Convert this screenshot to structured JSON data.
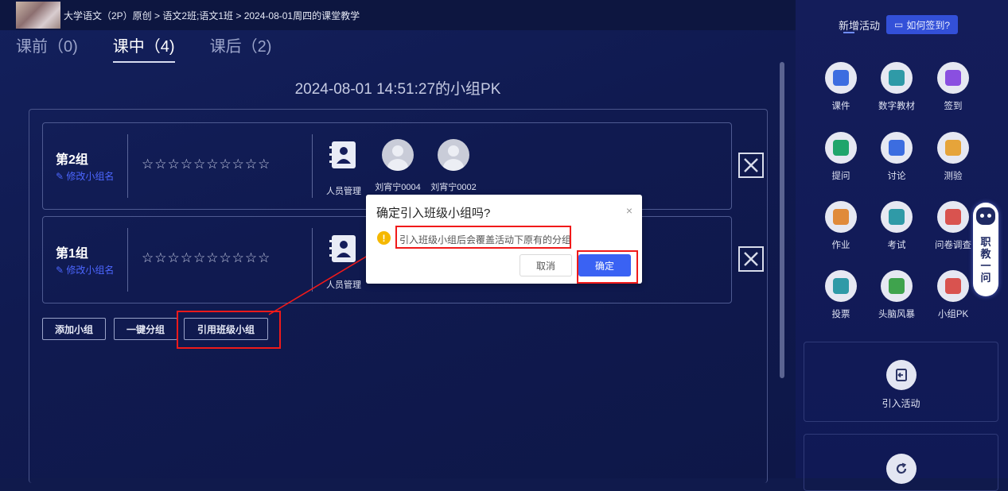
{
  "breadcrumb": "大学语文（2P）原创 > 语文2班;语文1班 > 2024-08-01周四的课堂教学",
  "tabs": [
    {
      "label": "课前（0)",
      "active": false
    },
    {
      "label": "课中（4)",
      "active": true
    },
    {
      "label": "课后（2)",
      "active": false
    }
  ],
  "pk_title": "2024-08-01 14:51:27的小组PK",
  "groups": [
    {
      "name": "第2组",
      "rename": "修改小组名",
      "stars": "☆☆☆☆☆☆☆☆☆☆",
      "manage_label": "人员管理",
      "members": [
        "刘宵宁0004",
        "刘宵宁0002"
      ]
    },
    {
      "name": "第1组",
      "rename": "修改小组名",
      "stars": "☆☆☆☆☆☆☆☆☆☆",
      "manage_label": "人员管理",
      "members": []
    }
  ],
  "actions": {
    "add_group": "添加小组",
    "auto_group": "一键分组",
    "import_group": "引用班级小组"
  },
  "dialog": {
    "title": "确定引入班级小组吗?",
    "message": "引入班级小组后会覆盖活动下原有的分组",
    "cancel": "取消",
    "ok": "确定",
    "close": "×"
  },
  "right_panel": {
    "header": "新增活动",
    "howto": "如何签到?",
    "tools": [
      {
        "label": "课件",
        "icon": "courseware-icon",
        "color": "#3c6de0"
      },
      {
        "label": "数字教材",
        "icon": "digital-textbook-icon",
        "color": "#2f9aa7"
      },
      {
        "label": "签到",
        "icon": "check-in-icon",
        "color": "#8a4fe0"
      },
      {
        "label": "提问",
        "icon": "question-icon",
        "color": "#1fa56b"
      },
      {
        "label": "讨论",
        "icon": "discussion-icon",
        "color": "#3c6de0"
      },
      {
        "label": "测验",
        "icon": "quiz-icon",
        "color": "#e6a43a"
      },
      {
        "label": "作业",
        "icon": "homework-icon",
        "color": "#e08a3a"
      },
      {
        "label": "考试",
        "icon": "exam-icon",
        "color": "#2f9aa7"
      },
      {
        "label": "问卷调查",
        "icon": "survey-icon",
        "color": "#d9534f"
      },
      {
        "label": "投票",
        "icon": "vote-icon",
        "color": "#2f9aa7"
      },
      {
        "label": "头脑风暴",
        "icon": "brainstorm-icon",
        "color": "#3fa34d"
      },
      {
        "label": "小组PK",
        "icon": "group-pk-icon",
        "color": "#d9534f"
      }
    ],
    "import_activity": "引入活动"
  },
  "assistant": {
    "label": "职教一问"
  }
}
